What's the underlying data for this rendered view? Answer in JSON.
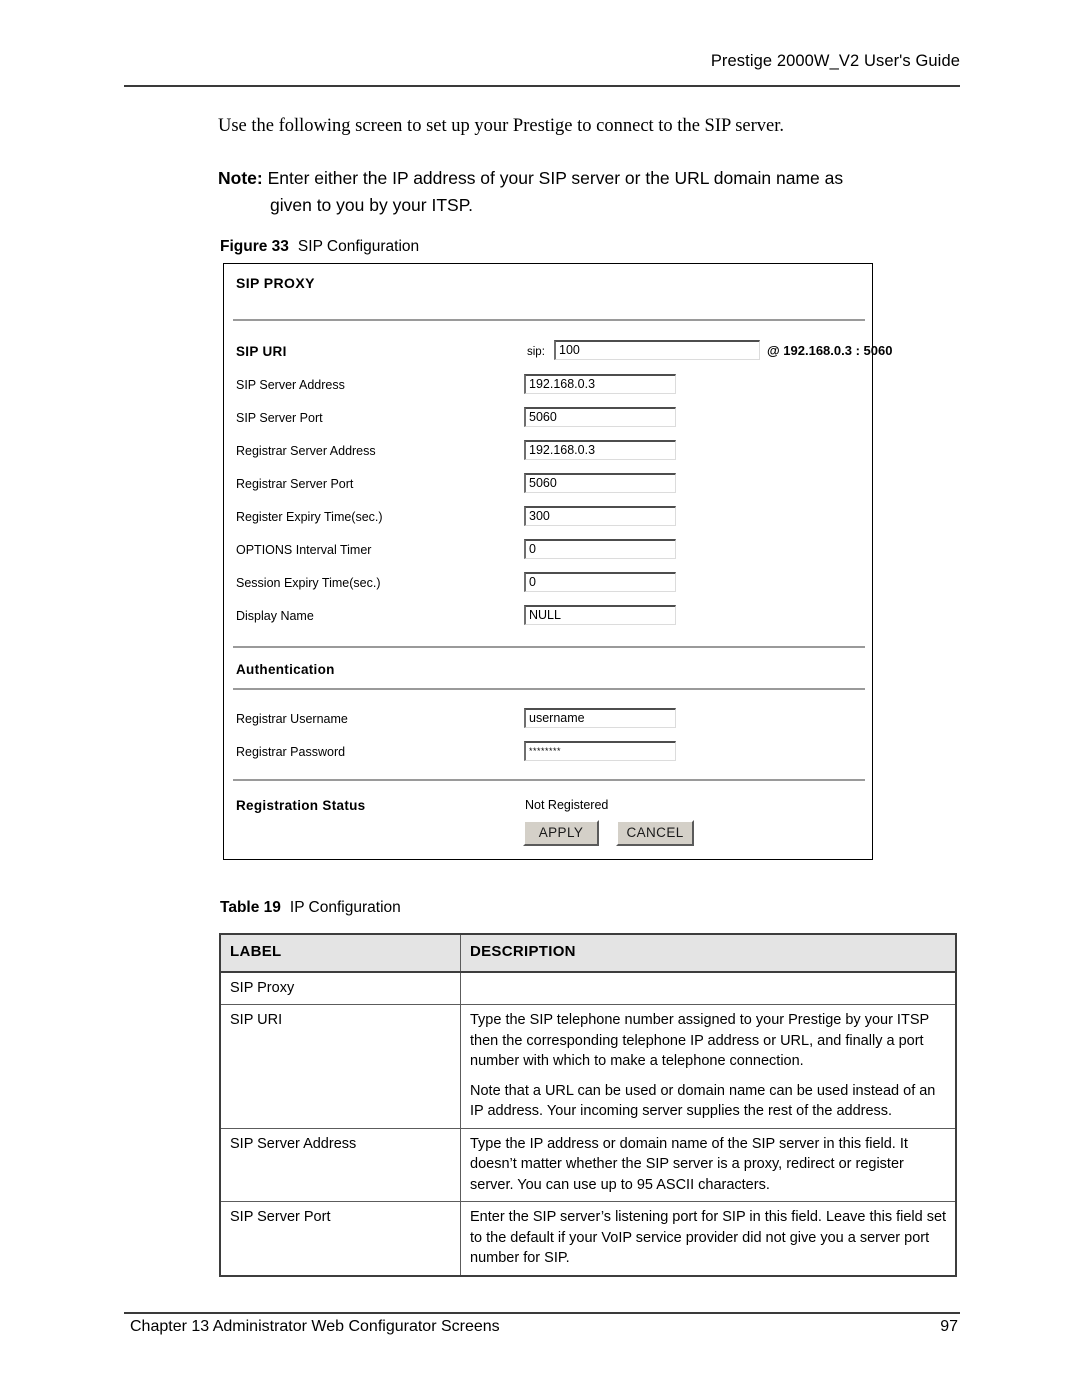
{
  "header": {
    "running_head": "Prestige 2000W_V2 User's Guide"
  },
  "body": {
    "intro": "Use the following screen to set up your Prestige to connect to the SIP server.",
    "note_label": "Note:",
    "note_line1": "Enter either the IP address of your SIP server or the URL domain name as",
    "note_line2": "given to you by your ITSP."
  },
  "figure": {
    "number": "Figure 33",
    "title": "SIP Configuration",
    "panel": {
      "title": "SIP PROXY",
      "sip_uri": {
        "label": "SIP URI",
        "prefix": "sip:",
        "value": "100",
        "suffix": "@ 192.168.0.3 : 5060"
      },
      "fields": [
        {
          "label": "SIP Server Address",
          "value": "192.168.0.3"
        },
        {
          "label": "SIP Server Port",
          "value": "5060"
        },
        {
          "label": "Registrar Server Address",
          "value": "192.168.0.3"
        },
        {
          "label": "Registrar Server Port",
          "value": "5060"
        },
        {
          "label": "Register Expiry Time(sec.)",
          "value": "300"
        },
        {
          "label": "OPTIONS Interval Timer",
          "value": "0"
        },
        {
          "label": "Session Expiry Time(sec.)",
          "value": "0"
        },
        {
          "label": "Display Name",
          "value": "NULL"
        }
      ],
      "authentication": {
        "title": "Authentication",
        "username": {
          "label": "Registrar Username",
          "value": "username"
        },
        "password": {
          "label": "Registrar Password",
          "value": "********"
        }
      },
      "registration": {
        "label": "Registration Status",
        "value": "Not Registered"
      },
      "buttons": {
        "apply": "APPLY",
        "cancel": "CANCEL"
      }
    }
  },
  "table": {
    "number": "Table 19",
    "title": "IP Configuration",
    "columns": [
      "LABEL",
      "DESCRIPTION"
    ],
    "rows": [
      {
        "label": "SIP Proxy",
        "paragraphs": []
      },
      {
        "label": "SIP URI",
        "paragraphs": [
          "Type the SIP telephone number assigned to your Prestige by your ITSP then the corresponding telephone IP address or URL, and finally a port number with which to make a telephone connection.",
          "Note that a URL can be used or domain name can be used instead of an IP address. Your incoming server supplies the rest of the address."
        ]
      },
      {
        "label": "SIP Server Address",
        "paragraphs": [
          "Type the IP address or domain name of the SIP server in this field. It doesn’t matter whether the SIP server is a proxy, redirect or register server. You can use up to 95 ASCII characters."
        ]
      },
      {
        "label": "SIP Server Port",
        "paragraphs": [
          "Enter the SIP server’s listening port for SIP in this field. Leave this field set to the default if your VoIP service provider did not give you a server port number for SIP."
        ]
      }
    ]
  },
  "footer": {
    "chapter": "Chapter 13 Administrator Web Configurator Screens",
    "page_number": "97"
  }
}
